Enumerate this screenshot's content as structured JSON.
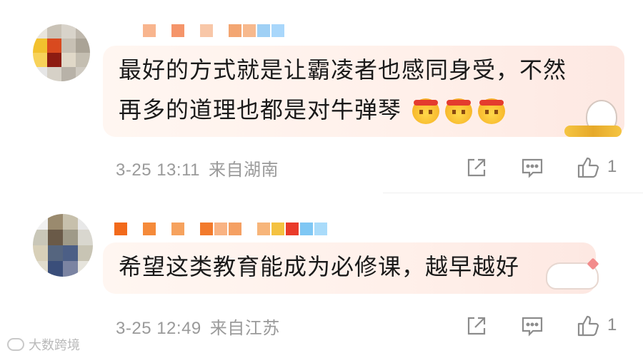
{
  "comments": [
    {
      "text_line1": "最好的方式就是让霸凌者也感同身受，不然",
      "text_line2": "再多的道理也都是对牛弹琴",
      "emojis": [
        "tongue-cheek-emoji",
        "tongue-cheek-emoji",
        "tongue-cheek-emoji"
      ],
      "time": "3-25 13:11",
      "location": "来自湖南",
      "like_count": "1"
    },
    {
      "text": "希望这类教育能成为必修课，越早越好",
      "time": "3-25 12:49",
      "location": "来自江苏",
      "like_count": "1"
    }
  ],
  "icons": {
    "share": "share-icon",
    "reply": "comment-icon",
    "like": "thumbs-up-icon"
  },
  "watermark": {
    "text": "大数跨境"
  },
  "colors": {
    "text": "#1a1a1a",
    "meta": "#9a9a9a",
    "bubble": "#fff0ea"
  }
}
